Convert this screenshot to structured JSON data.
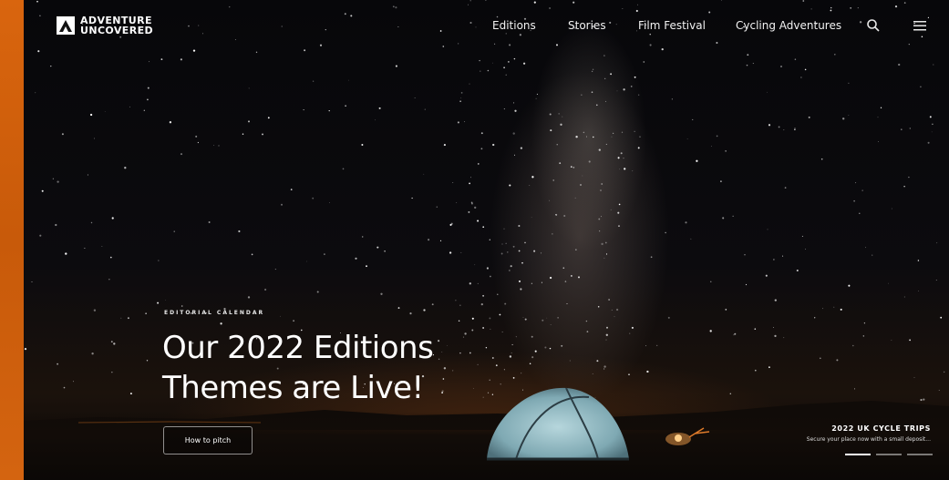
{
  "brand": {
    "line1": "ADVENTURE",
    "line2": "UNCOVERED",
    "icon": "mountain-logo-icon",
    "accent_color": "#d9650e"
  },
  "nav": {
    "items": [
      {
        "label": "Editions"
      },
      {
        "label": "Stories"
      },
      {
        "label": "Film Festival"
      },
      {
        "label": "Cycling Adventures"
      }
    ],
    "search_icon": "search-icon",
    "menu_icon": "hamburger-menu-icon"
  },
  "hero": {
    "eyebrow": "EDITORIAL CALENDAR",
    "headline_line1": "Our 2022 Editions",
    "headline_line2": "Themes are Live!",
    "cta_label": "How to pitch"
  },
  "promo": {
    "title": "2022 UK CYCLE TRIPS",
    "subtitle": "Secure your place now with a small deposit...",
    "slides_total": 3,
    "active_slide": 1
  }
}
